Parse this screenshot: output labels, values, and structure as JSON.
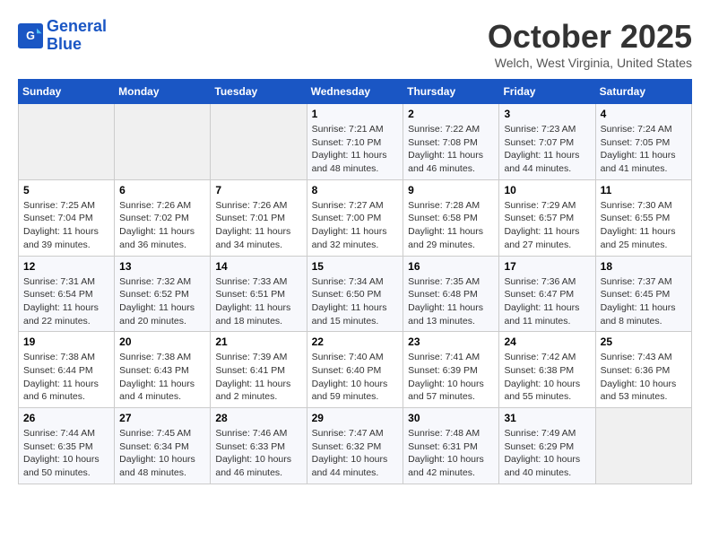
{
  "header": {
    "logo_line1": "General",
    "logo_line2": "Blue",
    "month": "October 2025",
    "location": "Welch, West Virginia, United States"
  },
  "weekdays": [
    "Sunday",
    "Monday",
    "Tuesday",
    "Wednesday",
    "Thursday",
    "Friday",
    "Saturday"
  ],
  "weeks": [
    [
      {
        "day": "",
        "info": ""
      },
      {
        "day": "",
        "info": ""
      },
      {
        "day": "",
        "info": ""
      },
      {
        "day": "1",
        "info": "Sunrise: 7:21 AM\nSunset: 7:10 PM\nDaylight: 11 hours\nand 48 minutes."
      },
      {
        "day": "2",
        "info": "Sunrise: 7:22 AM\nSunset: 7:08 PM\nDaylight: 11 hours\nand 46 minutes."
      },
      {
        "day": "3",
        "info": "Sunrise: 7:23 AM\nSunset: 7:07 PM\nDaylight: 11 hours\nand 44 minutes."
      },
      {
        "day": "4",
        "info": "Sunrise: 7:24 AM\nSunset: 7:05 PM\nDaylight: 11 hours\nand 41 minutes."
      }
    ],
    [
      {
        "day": "5",
        "info": "Sunrise: 7:25 AM\nSunset: 7:04 PM\nDaylight: 11 hours\nand 39 minutes."
      },
      {
        "day": "6",
        "info": "Sunrise: 7:26 AM\nSunset: 7:02 PM\nDaylight: 11 hours\nand 36 minutes."
      },
      {
        "day": "7",
        "info": "Sunrise: 7:26 AM\nSunset: 7:01 PM\nDaylight: 11 hours\nand 34 minutes."
      },
      {
        "day": "8",
        "info": "Sunrise: 7:27 AM\nSunset: 7:00 PM\nDaylight: 11 hours\nand 32 minutes."
      },
      {
        "day": "9",
        "info": "Sunrise: 7:28 AM\nSunset: 6:58 PM\nDaylight: 11 hours\nand 29 minutes."
      },
      {
        "day": "10",
        "info": "Sunrise: 7:29 AM\nSunset: 6:57 PM\nDaylight: 11 hours\nand 27 minutes."
      },
      {
        "day": "11",
        "info": "Sunrise: 7:30 AM\nSunset: 6:55 PM\nDaylight: 11 hours\nand 25 minutes."
      }
    ],
    [
      {
        "day": "12",
        "info": "Sunrise: 7:31 AM\nSunset: 6:54 PM\nDaylight: 11 hours\nand 22 minutes."
      },
      {
        "day": "13",
        "info": "Sunrise: 7:32 AM\nSunset: 6:52 PM\nDaylight: 11 hours\nand 20 minutes."
      },
      {
        "day": "14",
        "info": "Sunrise: 7:33 AM\nSunset: 6:51 PM\nDaylight: 11 hours\nand 18 minutes."
      },
      {
        "day": "15",
        "info": "Sunrise: 7:34 AM\nSunset: 6:50 PM\nDaylight: 11 hours\nand 15 minutes."
      },
      {
        "day": "16",
        "info": "Sunrise: 7:35 AM\nSunset: 6:48 PM\nDaylight: 11 hours\nand 13 minutes."
      },
      {
        "day": "17",
        "info": "Sunrise: 7:36 AM\nSunset: 6:47 PM\nDaylight: 11 hours\nand 11 minutes."
      },
      {
        "day": "18",
        "info": "Sunrise: 7:37 AM\nSunset: 6:45 PM\nDaylight: 11 hours\nand 8 minutes."
      }
    ],
    [
      {
        "day": "19",
        "info": "Sunrise: 7:38 AM\nSunset: 6:44 PM\nDaylight: 11 hours\nand 6 minutes."
      },
      {
        "day": "20",
        "info": "Sunrise: 7:38 AM\nSunset: 6:43 PM\nDaylight: 11 hours\nand 4 minutes."
      },
      {
        "day": "21",
        "info": "Sunrise: 7:39 AM\nSunset: 6:41 PM\nDaylight: 11 hours\nand 2 minutes."
      },
      {
        "day": "22",
        "info": "Sunrise: 7:40 AM\nSunset: 6:40 PM\nDaylight: 10 hours\nand 59 minutes."
      },
      {
        "day": "23",
        "info": "Sunrise: 7:41 AM\nSunset: 6:39 PM\nDaylight: 10 hours\nand 57 minutes."
      },
      {
        "day": "24",
        "info": "Sunrise: 7:42 AM\nSunset: 6:38 PM\nDaylight: 10 hours\nand 55 minutes."
      },
      {
        "day": "25",
        "info": "Sunrise: 7:43 AM\nSunset: 6:36 PM\nDaylight: 10 hours\nand 53 minutes."
      }
    ],
    [
      {
        "day": "26",
        "info": "Sunrise: 7:44 AM\nSunset: 6:35 PM\nDaylight: 10 hours\nand 50 minutes."
      },
      {
        "day": "27",
        "info": "Sunrise: 7:45 AM\nSunset: 6:34 PM\nDaylight: 10 hours\nand 48 minutes."
      },
      {
        "day": "28",
        "info": "Sunrise: 7:46 AM\nSunset: 6:33 PM\nDaylight: 10 hours\nand 46 minutes."
      },
      {
        "day": "29",
        "info": "Sunrise: 7:47 AM\nSunset: 6:32 PM\nDaylight: 10 hours\nand 44 minutes."
      },
      {
        "day": "30",
        "info": "Sunrise: 7:48 AM\nSunset: 6:31 PM\nDaylight: 10 hours\nand 42 minutes."
      },
      {
        "day": "31",
        "info": "Sunrise: 7:49 AM\nSunset: 6:29 PM\nDaylight: 10 hours\nand 40 minutes."
      },
      {
        "day": "",
        "info": ""
      }
    ]
  ]
}
